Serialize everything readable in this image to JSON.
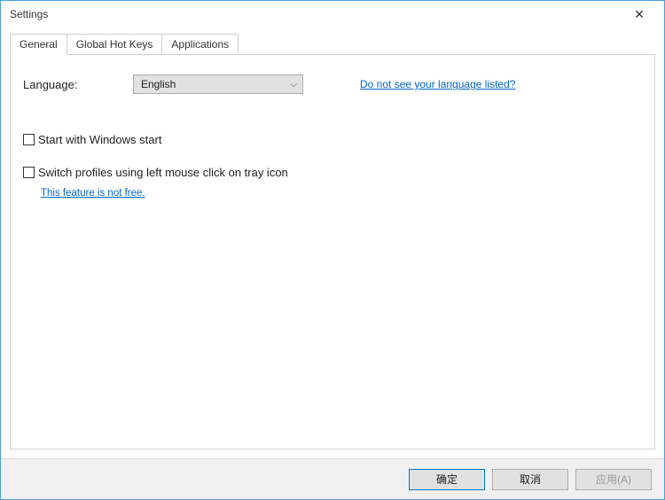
{
  "window": {
    "title": "Settings"
  },
  "tabs": {
    "general": "General",
    "globalHotKeys": "Global Hot Keys",
    "applications": "Applications"
  },
  "general": {
    "languageLabel": "Language:",
    "languageValue": "English",
    "languageNotListedLink": "Do not see your language listed?",
    "startWithWindows": "Start with Windows start",
    "switchProfiles": "Switch profiles using left mouse click on tray icon",
    "featureNotFreeLink": "This feature is not free."
  },
  "buttons": {
    "ok": "确定",
    "cancel": "取消",
    "apply": "应用(A)"
  }
}
